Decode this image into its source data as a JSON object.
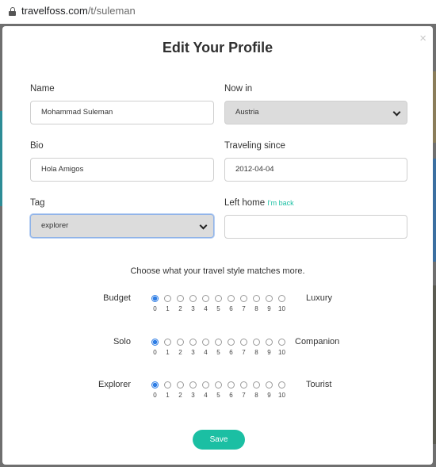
{
  "browser": {
    "url_host": "travelfoss.com",
    "url_path": "/t/suleman"
  },
  "modal": {
    "title": "Edit Your Profile",
    "close_glyph": "×"
  },
  "form": {
    "name": {
      "label": "Name",
      "value": "Mohammad Suleman"
    },
    "now_in": {
      "label": "Now in",
      "value": "Austria"
    },
    "bio": {
      "label": "Bio",
      "value": "Hola Amigos"
    },
    "traveling_since": {
      "label": "Traveling since",
      "value": "2012-04-04"
    },
    "tag": {
      "label": "Tag",
      "value": "explorer"
    },
    "left_home": {
      "label": "Left home",
      "link": "I'm back",
      "value": ""
    }
  },
  "style": {
    "prompt": "Choose what your travel style matches more.",
    "numbers": [
      "0",
      "1",
      "2",
      "3",
      "4",
      "5",
      "6",
      "7",
      "8",
      "9",
      "10"
    ],
    "scales": [
      {
        "left": "Budget",
        "right": "Luxury",
        "selected": 0
      },
      {
        "left": "Solo",
        "right": "Companion",
        "selected": 0
      },
      {
        "left": "Explorer",
        "right": "Tourist",
        "selected": 0
      }
    ]
  },
  "save_label": "Save",
  "colors": {
    "accent": "#1bbfa3",
    "radio": "#2f7ee5",
    "backdrop": "#6f6f6f"
  }
}
